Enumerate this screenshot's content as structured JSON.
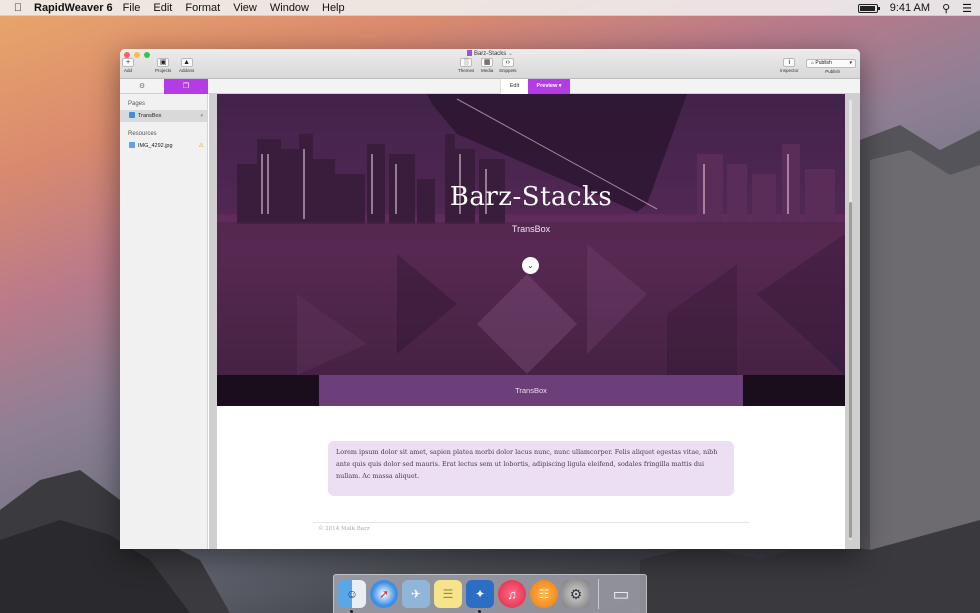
{
  "menubar": {
    "app_name": "RapidWeaver 6",
    "items": [
      "File",
      "Edit",
      "Format",
      "View",
      "Window",
      "Help"
    ],
    "clock": "9:41 AM"
  },
  "window": {
    "title": "Barz-Stacks",
    "toolbar": {
      "add": "Add",
      "projects": "Projects",
      "addons": "Addons",
      "themes": "Themes",
      "media": "Media",
      "snippets": "Snippets",
      "inspector": "Inspector",
      "publish": "Publish",
      "publish_sub": "Publish"
    },
    "tabs": {
      "edit": "Edit",
      "preview": "Preview"
    }
  },
  "sidebar": {
    "pages_header": "Pages",
    "pages": [
      {
        "label": "TransBox"
      }
    ],
    "resources_header": "Resources",
    "resources": [
      {
        "label": "IMG_4292.jpg"
      }
    ]
  },
  "preview": {
    "hero_title": "Barz-Stacks",
    "hero_subtitle": "TransBox",
    "bar_label": "TransBox",
    "lorem": "Lorem ipsum dolor sit amet, sapien platea morbi dolor lacus nunc, nunc ullamcorper. Felis aliquet egestas vitae, nibh ante quis quis dolor sed mauris. Erat lectus sem ut lobortis, adipiscing ligula eleifend, sodales fringilla mattis dui nullam. Ac massa aliquet.",
    "footer": "© 2014 Malk Barz"
  },
  "colors": {
    "accent": "#b33ce6",
    "bar": "#6c3f7a",
    "callout_bg": "#eddff3"
  },
  "dock": {
    "icons": [
      "finder-icon",
      "safari-icon",
      "preview-icon",
      "notes-icon",
      "rapidweaver-icon",
      "itunes-icon",
      "ibooks-icon",
      "system-preferences-icon",
      "trash-icon"
    ]
  }
}
